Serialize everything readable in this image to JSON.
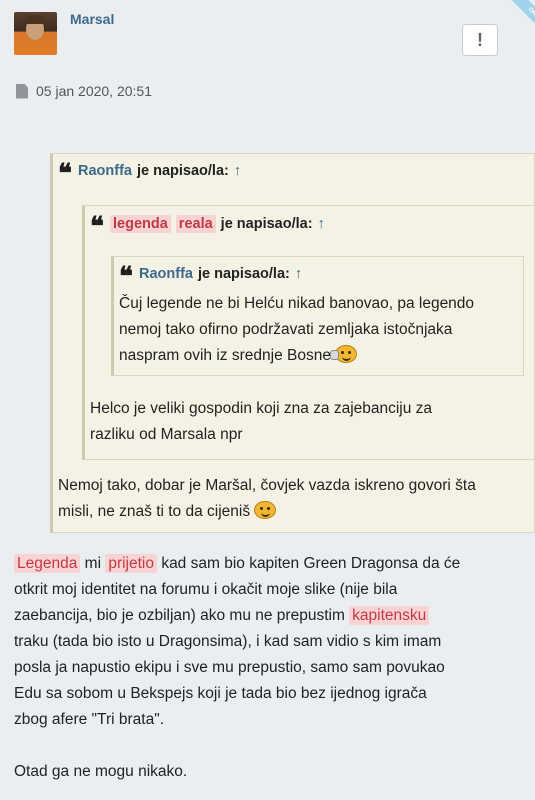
{
  "post": {
    "username": "Marsal",
    "report_label": "!",
    "corner_badge": "ON",
    "timestamp": "05 jan 2020, 20:51"
  },
  "quote_outer": {
    "author": "Raonffa",
    "suffix": "je napisao/la:",
    "arrow": "↑",
    "text_line1": "Nemoj tako, dobar je Maršal, čovjek vazda iskreno govori šta",
    "text_line2": "misli, ne znaš ti to da cijeniš"
  },
  "quote_middle": {
    "author_part1": "legenda",
    "author_part2": "reala",
    "suffix": "je napisao/la:",
    "arrow": "↑",
    "text_line1": "Helco je veliki gospodin koji zna za zajebanciju za",
    "text_line2": "razliku od Marsala npr"
  },
  "quote_inner": {
    "author": "Raonffa",
    "suffix": "je napisao/la:",
    "arrow": "↑",
    "text_line1": "Čuj legende ne bi Helću nikad banovao, pa legendo",
    "text_line2": "nemoj tako ofirno podržavati zemljaka istočnjaka",
    "text_line3": "naspram ovih iz srednje Bosne"
  },
  "body": {
    "hl1": "Legenda",
    "w1": "mi",
    "hl2": "prijetio",
    "w2": "kad sam bio kapiten Green Dragonsa da će",
    "line2": "otkrit moj identitet na forumu i okačit moje slike (nije bila",
    "line3_a": "zaebancija, bio je ozbiljan) ako mu ne prepustim",
    "hl3": "kapitensku",
    "line4": "traku (tada bio isto u Dragonsima), i kad sam vidio s kim imam",
    "line5": "posla ja napustio ekipu i sve mu prepustio, samo sam povukao",
    "line6": "Edu sa sobom u Bekspejs koji je tada bio bez ijednog igrača",
    "line7": "zbog afere \"Tri brata\".",
    "line8": "Otad ga ne mogu nikako."
  },
  "icons": {
    "quote": "quote-icon",
    "document": "document-icon",
    "smiley_thinking": "thinking-smiley-icon",
    "smiley_happy": "happy-smiley-icon"
  }
}
